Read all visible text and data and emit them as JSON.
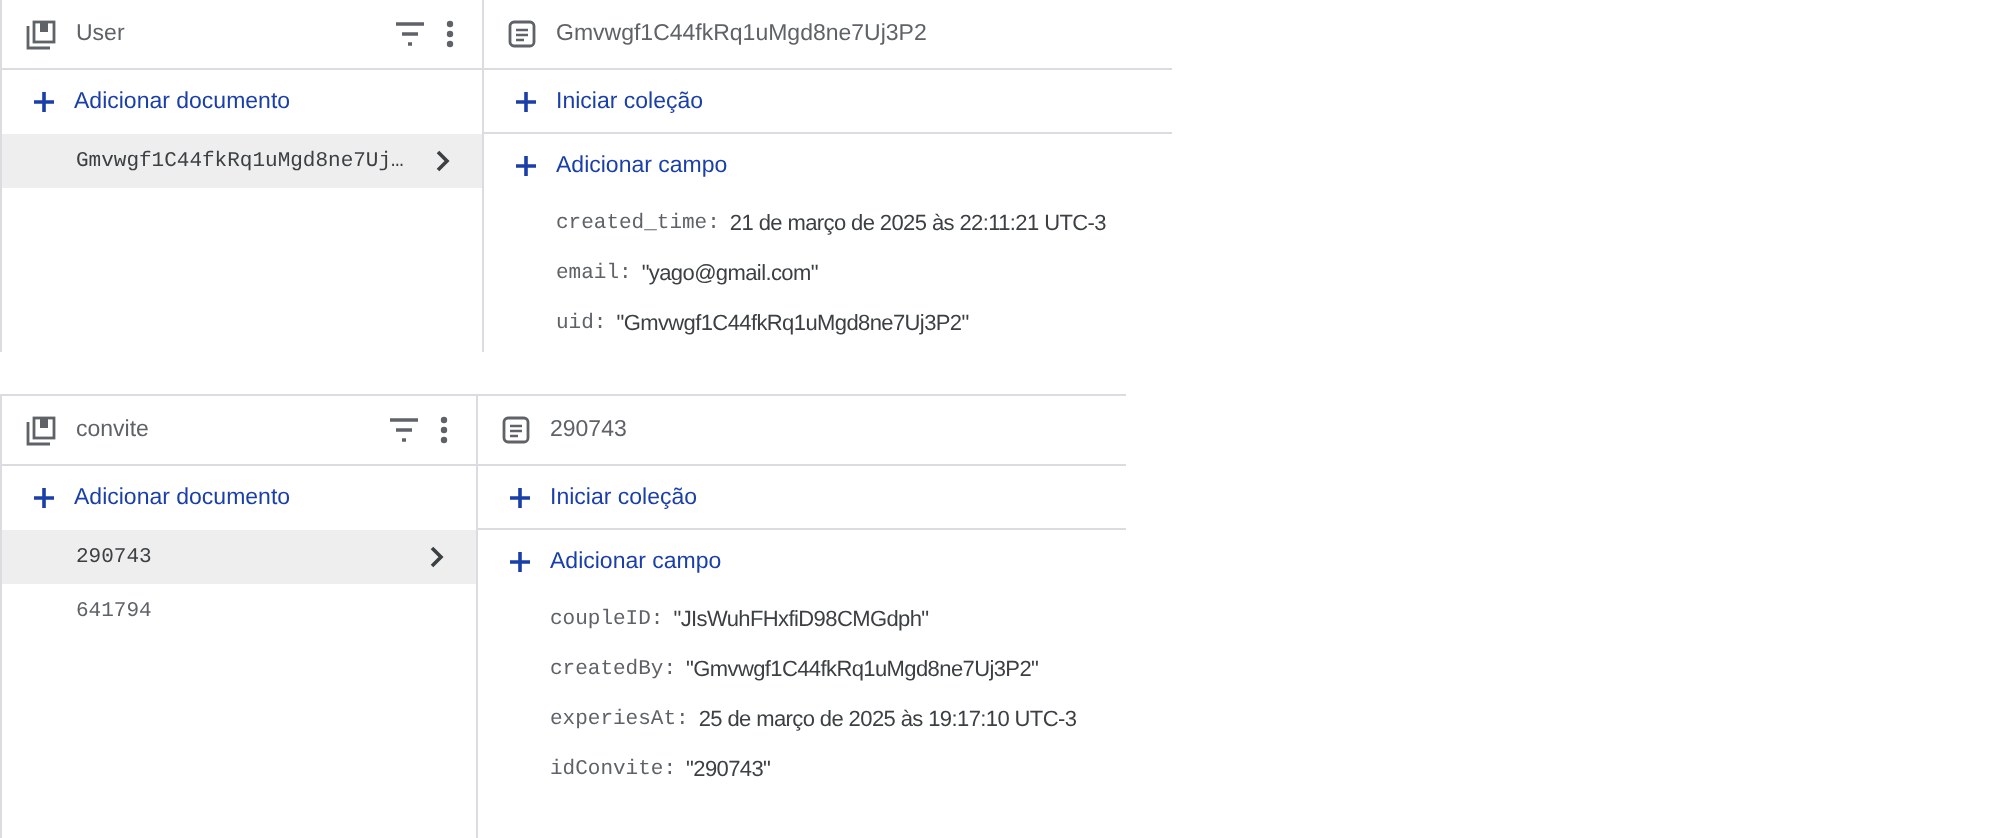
{
  "panels": [
    {
      "collection": {
        "name": "User",
        "add_label": "Adicionar documento",
        "documents": [
          {
            "id": "Gmvwgf1C44fkRq1uMgd8ne7Uj…",
            "selected": true
          }
        ]
      },
      "document": {
        "id": "Gmvwgf1C44fkRq1uMgd8ne7Uj3P2",
        "start_label": "Iniciar coleção",
        "add_label": "Adicionar campo",
        "fields": [
          {
            "key": "created_time:",
            "value": "21 de março de 2025 às 22:11:21 UTC-3"
          },
          {
            "key": "email:",
            "value": "\"yago@gmail.com\""
          },
          {
            "key": "uid:",
            "value": "\"Gmvwgf1C44fkRq1uMgd8ne7Uj3P2\""
          }
        ]
      }
    },
    {
      "collection": {
        "name": "convite",
        "add_label": "Adicionar documento",
        "documents": [
          {
            "id": "290743",
            "selected": true
          },
          {
            "id": "641794",
            "selected": false
          }
        ]
      },
      "document": {
        "id": "290743",
        "start_label": "Iniciar coleção",
        "add_label": "Adicionar campo",
        "fields": [
          {
            "key": "coupleID:",
            "value": "\"JIsWuhFHxfiD98CMGdph\""
          },
          {
            "key": "createdBy:",
            "value": "\"Gmvwgf1C44fkRq1uMgd8ne7Uj3P2\""
          },
          {
            "key": "experiesAt:",
            "value": "25 de março de 2025 às 19:17:10 UTC-3"
          },
          {
            "key": "idConvite:",
            "value": "\"290743\""
          }
        ]
      }
    }
  ]
}
